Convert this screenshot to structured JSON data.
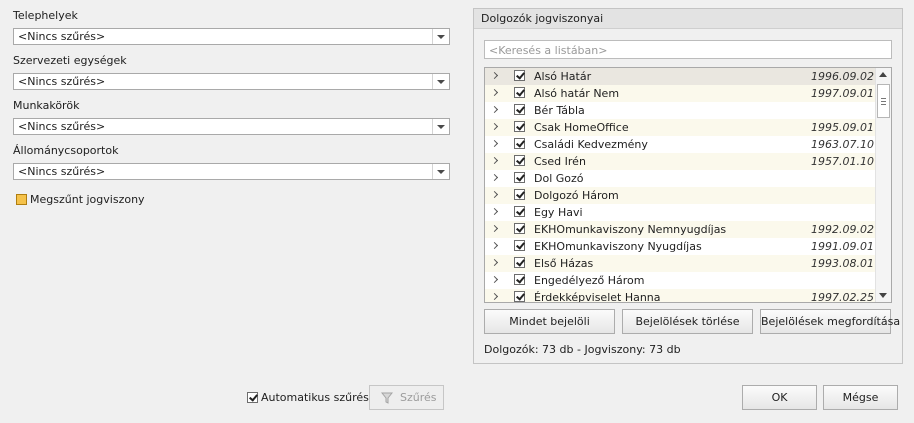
{
  "filters": [
    {
      "label": "Telephelyek",
      "value": "<Nincs szűrés>"
    },
    {
      "label": "Szervezeti egységek",
      "value": "<Nincs szűrés>"
    },
    {
      "label": "Munkakörök",
      "value": "<Nincs szűrés>"
    },
    {
      "label": "Állománycsoportok",
      "value": "<Nincs szűrés>"
    }
  ],
  "terminated": {
    "label": "Megszűnt jogviszony",
    "checked": false
  },
  "panel": {
    "title": "Dolgozók jogviszonyai",
    "search_placeholder": "<Keresés a listában>",
    "rows": [
      {
        "name": "Alsó Határ",
        "date": "1996.09.02",
        "checked": true
      },
      {
        "name": "Alsó határ Nem",
        "date": "1997.09.01",
        "checked": true
      },
      {
        "name": "Bér Tábla",
        "date": "",
        "checked": true
      },
      {
        "name": "Csak HomeOffice",
        "date": "1995.09.01",
        "checked": true
      },
      {
        "name": "Családi Kedvezmény",
        "date": "1963.07.10",
        "checked": true
      },
      {
        "name": "Csed Irén",
        "date": "1957.01.10",
        "checked": true
      },
      {
        "name": "Dol Gozó",
        "date": "",
        "checked": true
      },
      {
        "name": "Dolgozó Három",
        "date": "",
        "checked": true
      },
      {
        "name": "Egy Havi",
        "date": "",
        "checked": true
      },
      {
        "name": "EKHOmunkaviszony Nemnyugdíjas",
        "date": "1992.09.02",
        "checked": true
      },
      {
        "name": "EKHOmunkaviszony Nyugdíjas",
        "date": "1991.09.01",
        "checked": true
      },
      {
        "name": "Első Házas",
        "date": "1993.08.01",
        "checked": true
      },
      {
        "name": "Engedélyező Három",
        "date": "",
        "checked": true
      },
      {
        "name": "Érdekképviselet Hanna",
        "date": "1997.02.25",
        "checked": true
      }
    ],
    "buttons": {
      "select_all": "Mindet bejelöli",
      "clear": "Bejelölések törlése",
      "invert": "Bejelölések megfordítása"
    },
    "summary": "Dolgozók: 73 db - Jogviszony: 73 db"
  },
  "footer": {
    "auto_filter_label": "Automatikus szűrés",
    "auto_filter_checked": true,
    "filter_button": "Szűrés",
    "ok": "OK",
    "cancel": "Mégse"
  },
  "colors": {
    "background": "#f0f0f0",
    "row_alt": "#fbf9ec",
    "row_selected": "#eae7e0",
    "checkbox_amber": "#f5c24a"
  },
  "icons": [
    "dropdown-arrow-icon",
    "expand-chevron-icon",
    "filter-funnel-icon",
    "scroll-up-icon",
    "scroll-down-icon"
  ]
}
